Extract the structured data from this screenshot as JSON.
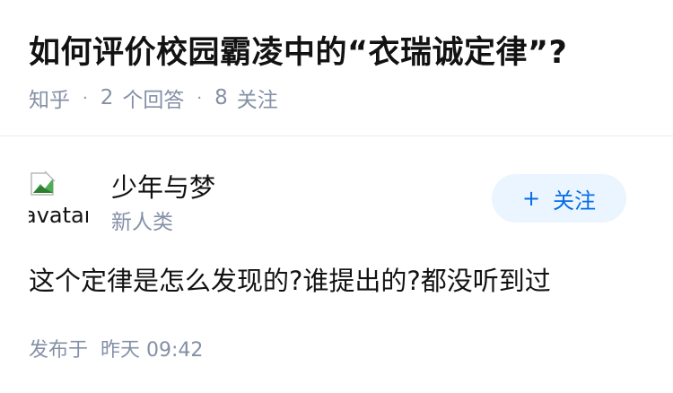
{
  "question": {
    "title": "如何评价校园霸凌中的“衣瑞诚定律”?",
    "source": "知乎",
    "answer_count": "2",
    "answer_label": "个回答",
    "follow_count": "8",
    "follow_label": "关注"
  },
  "author": {
    "avatar_alt": "avatar",
    "name": "少年与梦",
    "badge": "新人类",
    "follow_button_label": "关注",
    "follow_icon": "plus-icon"
  },
  "answer": {
    "content": "这个定律是怎么发现的?谁提出的?都没听到过",
    "published_label": "发布于",
    "published_time": "昨天 09:42"
  },
  "colors": {
    "meta_text": "#8590a6",
    "follow_bg": "#ebf5ff",
    "follow_text": "#056de8"
  }
}
